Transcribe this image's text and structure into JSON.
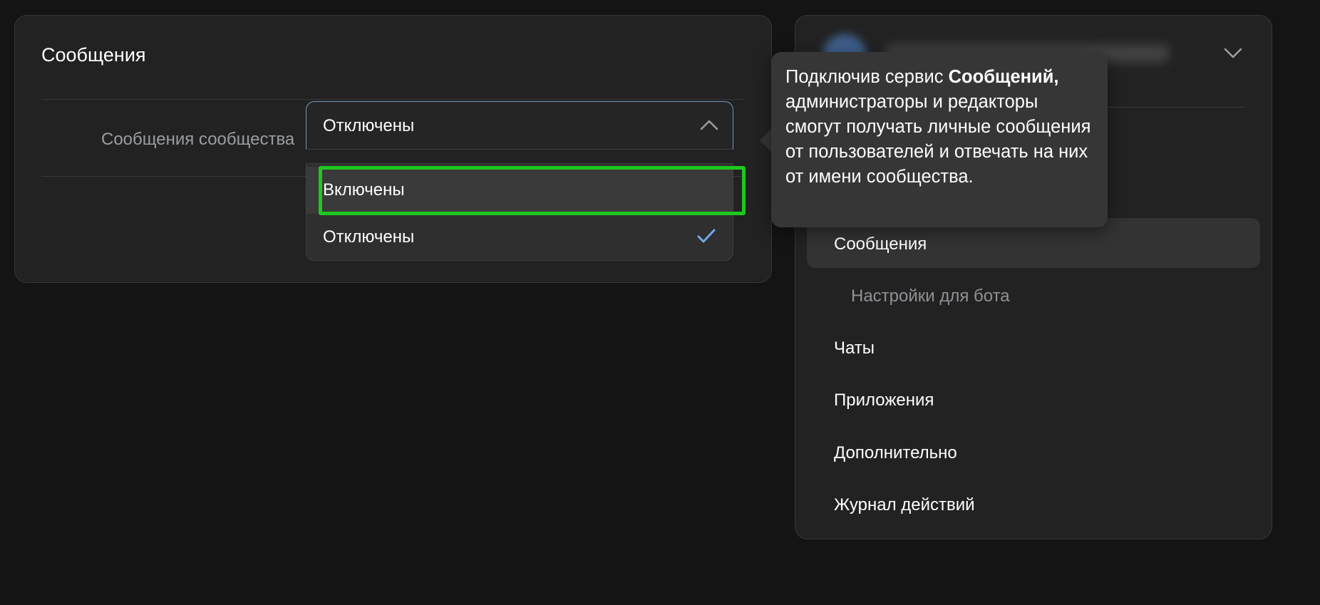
{
  "card": {
    "title": "Сообщения",
    "row_label": "Сообщения сообщества",
    "select_value": "Отключены",
    "options": [
      {
        "label": "Включены",
        "selected": false
      },
      {
        "label": "Отключены",
        "selected": true
      }
    ]
  },
  "tooltip": {
    "prefix": "Подключив сервис ",
    "bold": "Сообщений,",
    "suffix": " администраторы и редакторы смогут получать личные сообщения от пользователей и отвечать на них от имени сообщества."
  },
  "sidebar": {
    "items": [
      {
        "label": "Сообщения"
      },
      {
        "label": "Настройки для бота"
      },
      {
        "label": "Чаты"
      },
      {
        "label": "Приложения"
      },
      {
        "label": "Дополнительно"
      },
      {
        "label": "Журнал действий"
      }
    ]
  },
  "colors": {
    "accent": "#6f96c6",
    "check": "#71aaeb",
    "highlight": "#1ec81e"
  }
}
